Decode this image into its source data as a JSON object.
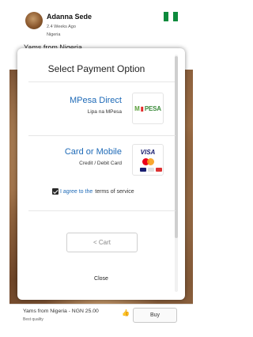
{
  "seller": {
    "name": "Adanna Sede",
    "time_ago": "2.4 Weeks Ago",
    "location": "Nigeria",
    "flag_icon": "nigeria-flag-icon",
    "flag_colors": [
      "#0c8a3c",
      "#ffffff",
      "#0c8a3c"
    ]
  },
  "listing": {
    "title_partial": "Yams from Nigeria",
    "bottom_title": "Yams from Nigeria - NGN 25.00",
    "bottom_subtitle": "Best quality",
    "like_icon": "thumbs-up-icon",
    "buy_label": "Buy"
  },
  "modal": {
    "title": "Select Payment Option",
    "options": [
      {
        "title": "MPesa Direct",
        "subtitle": "Lipa na MPesa",
        "logo_icon": "mpesa-logo",
        "logo_text_a": "M",
        "logo_text_b": "PESA"
      },
      {
        "title": "Card or Mobile",
        "subtitle": "Credit / Debit Card",
        "logo_icon": "visa-mastercard-logo",
        "logo_text": "VISA"
      }
    ],
    "terms": {
      "checked": true,
      "text_before": "I agree to the",
      "link_text": "terms of service"
    },
    "cart_label": "< Cart",
    "close_label": "Close"
  },
  "colors": {
    "accent": "#1e6ab7",
    "mpesa_green": "#3b8b3b",
    "visa_blue": "#1a1f71"
  }
}
